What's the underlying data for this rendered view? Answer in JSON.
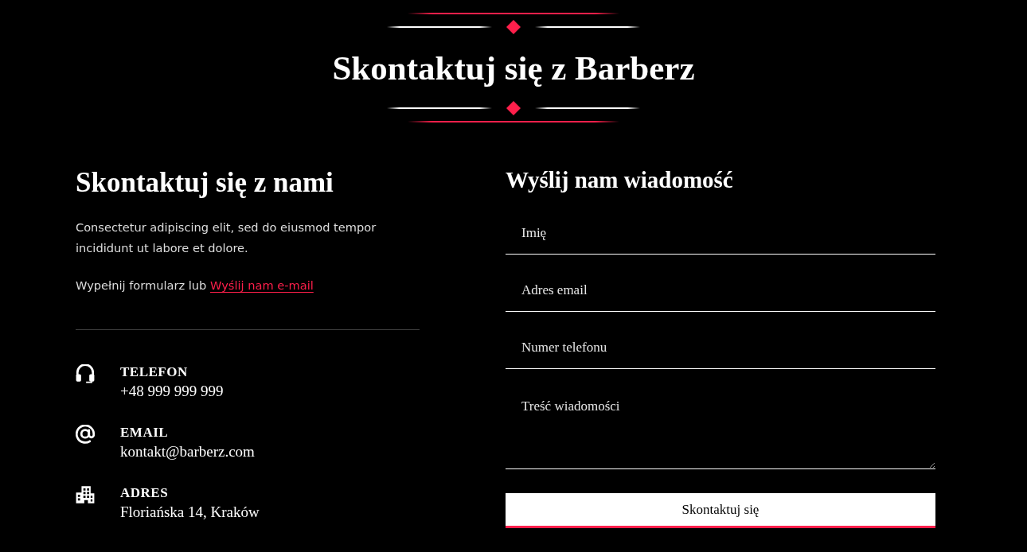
{
  "header": {
    "title": "Skontaktuj się z Barberz"
  },
  "contact_info": {
    "heading": "Skontaktuj się z nami",
    "description": "Consectetur adipiscing elit, sed do eiusmod tempor incididunt ut labore et dolore.",
    "cta_text": "Wypełnij formularz lub",
    "cta_link": "Wyślij nam e-mail",
    "items": [
      {
        "kind": "phone",
        "label": "TELEFON",
        "value": "+48 999 999 999"
      },
      {
        "kind": "email",
        "label": "EMAIL",
        "value": "kontakt@barberz.com"
      },
      {
        "kind": "address",
        "label": "ADRES",
        "value": "Floriańska 14, Kraków"
      }
    ]
  },
  "form": {
    "heading": "Wyślij nam wiadomość",
    "fields": [
      {
        "kind": "name",
        "placeholder": "Imię"
      },
      {
        "kind": "email",
        "placeholder": "Adres email"
      },
      {
        "kind": "phone",
        "placeholder": "Numer telefonu"
      },
      {
        "kind": "message",
        "placeholder": "Treść wiadomości"
      }
    ],
    "submit": "Skontaktuj się"
  }
}
